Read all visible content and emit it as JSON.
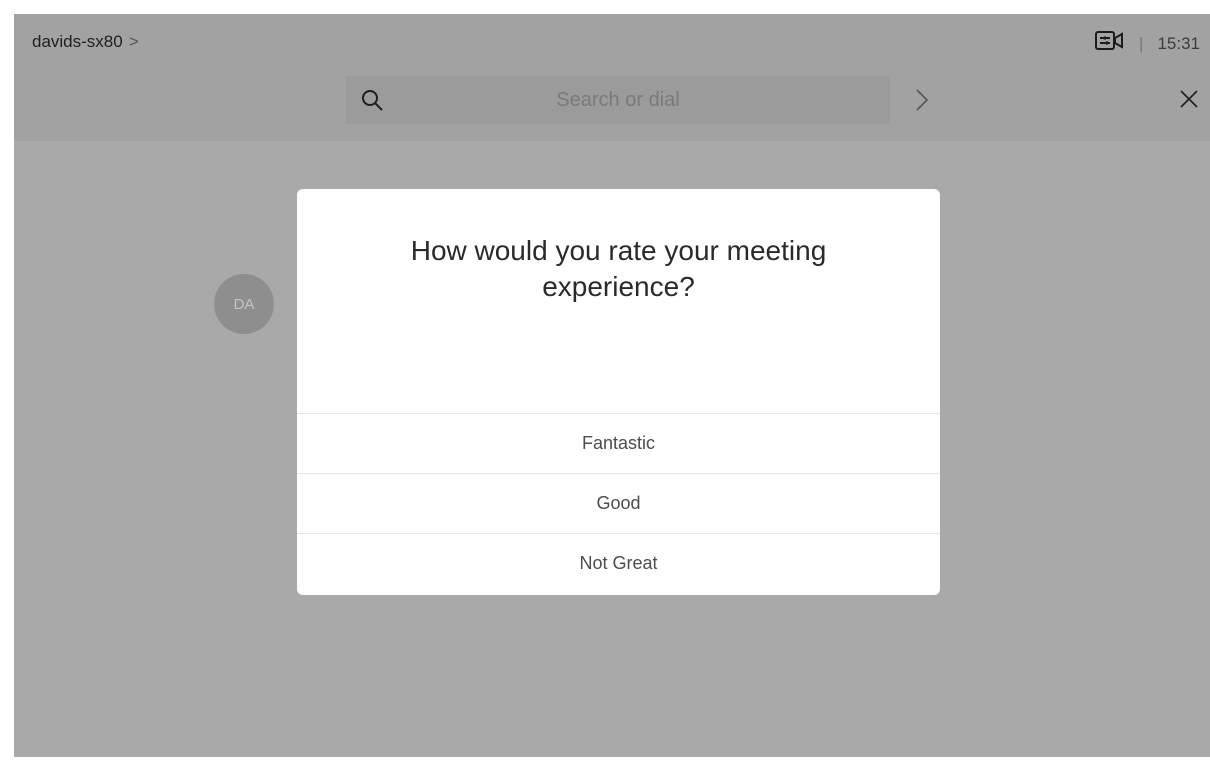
{
  "header": {
    "device_name": "davids-sx80",
    "device_chevron": ">",
    "time": "15:31",
    "separator": "|"
  },
  "search": {
    "placeholder": "Search or dial",
    "value": ""
  },
  "participant": {
    "initials": "DA"
  },
  "rating_dialog": {
    "question": "How would you rate your meeting experience?",
    "options": [
      {
        "label": "Fantastic"
      },
      {
        "label": "Good"
      },
      {
        "label": "Not Great"
      }
    ]
  },
  "icons": {
    "search": "search-icon",
    "go": "chevron-right-icon",
    "close": "close-icon",
    "camera_status": "camera-selfview-icon"
  },
  "colors": {
    "background_overlay": "#a9a9a9",
    "topbar": "#a2a2a2",
    "search_field": "#9b9b9b",
    "modal": "#ffffff",
    "avatar": "#8e8e8e"
  }
}
